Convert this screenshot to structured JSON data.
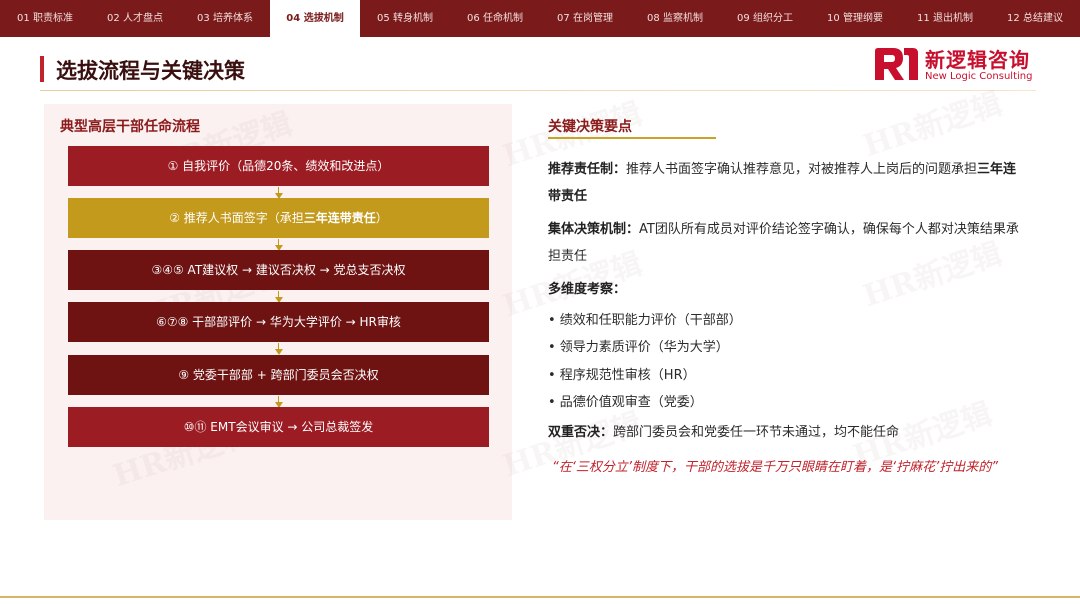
{
  "nav": {
    "tabs": [
      "01 职责标准",
      "02 人才盘点",
      "03 培养体系",
      "04 选拔机制",
      "05 转身机制",
      "06 任命机制",
      "07 在岗管理",
      "08 监察机制",
      "09 组织分工",
      "10 管理纲要",
      "11 退出机制",
      "12 总结建议"
    ],
    "active_index": 3
  },
  "page_title": "选拔流程与关键决策",
  "logo": {
    "cn": "新逻辑咨询",
    "en": "New Logic Consulting"
  },
  "watermark": "HR新逻辑",
  "flow": {
    "heading": "典型高层干部任命流程",
    "steps": [
      {
        "text": "① 自我评价（品德20条、绩效和改进点）"
      },
      {
        "pre": "② 推荐人书面签字（承担",
        "bold": "三年连带责任",
        "post": "）"
      },
      {
        "text": "③④⑤ AT建议权 → 建议否决权 → 党总支否决权"
      },
      {
        "text": "⑥⑦⑧ 干部部评价 → 华为大学评价 → HR审核"
      },
      {
        "text": "⑨ 党委干部部 + 跨部门委员会否决权"
      },
      {
        "text": "⑩⑪ EMT会议审议 → 公司总裁签发"
      }
    ]
  },
  "decisions": {
    "heading": "关键决策要点",
    "p1": {
      "label": "推荐责任制：",
      "text": "推荐人书面签字确认推荐意见，对被推荐人上岗后的问题承担",
      "highlight": "三年连带责任"
    },
    "p2": {
      "label": "集体决策机制：",
      "text": "AT团队所有成员对评价结论签字确认，确保每个人都对决策结果承担责任"
    },
    "p3": {
      "label": "多维度考察："
    },
    "bullets": [
      "• 绩效和任职能力评价（干部部）",
      "• 领导力素质评价（华为大学）",
      "• 程序规范性审核（HR）",
      "• 品德价值观审查（党委）"
    ],
    "p4": {
      "label": "双重否决：",
      "text": "跨部门委员会和党委任一环节未通过，均不能任命"
    },
    "quote": "“在‘三权分立’制度下，干部的选拔是千万只眼睛在盯着，是‘拧麻花’拧出来的”"
  },
  "colors": {
    "nav_bg": "#7a1a1a",
    "brand_red": "#c8102e",
    "step_red": "#9c1c24",
    "step_gold": "#c49a1c",
    "step_dark": "#6e1212",
    "quote": "#c0232c"
  }
}
